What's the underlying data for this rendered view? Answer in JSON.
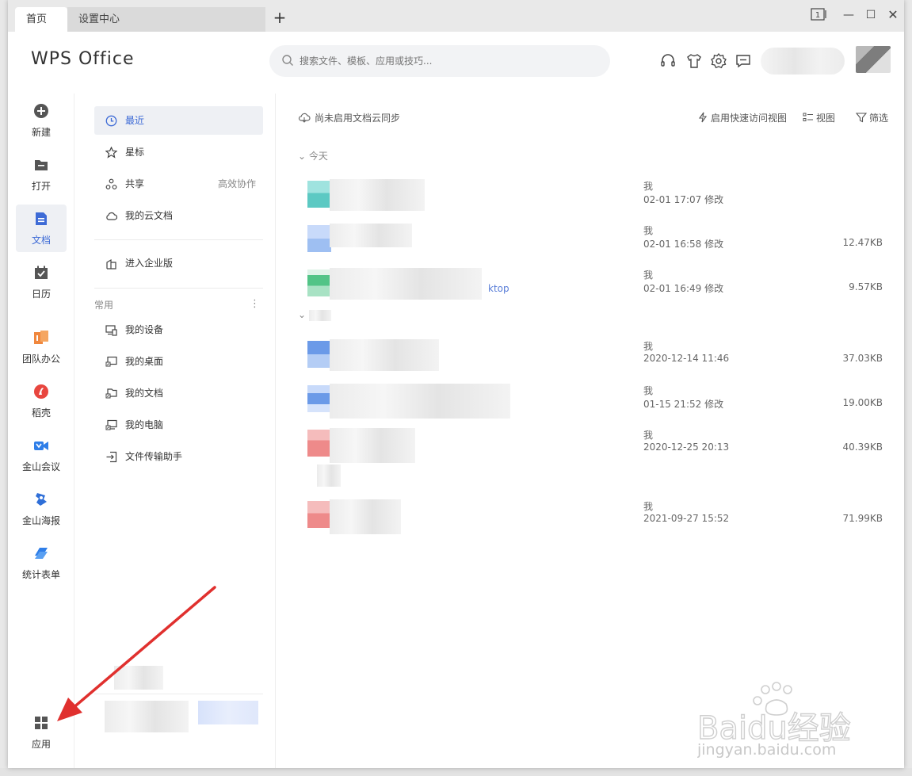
{
  "tabs": [
    {
      "label": "首页",
      "active": true
    },
    {
      "label": "设置中心",
      "active": false
    }
  ],
  "window_controls": {
    "pad": "1",
    "minimize": "—",
    "maximize": "☐",
    "close": "✕"
  },
  "header": {
    "logo": "WPS Office",
    "search_placeholder": "搜索文件、模板、应用或技巧..."
  },
  "left_bar": {
    "items": [
      {
        "label": "新建",
        "icon": "plus-circle-icon"
      },
      {
        "label": "打开",
        "icon": "folder-icon"
      },
      {
        "label": "文档",
        "icon": "document-icon",
        "active": true
      },
      {
        "label": "日历",
        "icon": "calendar-icon"
      },
      {
        "label": "团队办公",
        "icon": "team-icon"
      },
      {
        "label": "稻壳",
        "icon": "docer-icon"
      },
      {
        "label": "金山会议",
        "icon": "meeting-icon"
      },
      {
        "label": "金山海报",
        "icon": "poster-icon"
      },
      {
        "label": "统计表单",
        "icon": "form-icon"
      }
    ],
    "apps_label": "应用"
  },
  "nav": {
    "items": [
      {
        "label": "最近",
        "icon": "clock-icon",
        "active": true
      },
      {
        "label": "星标",
        "icon": "star-icon"
      },
      {
        "label": "共享",
        "icon": "share-icon",
        "extra": "高效协作"
      },
      {
        "label": "我的云文档",
        "icon": "cloud-icon"
      }
    ],
    "enterprise": "进入企业版",
    "section_label": "常用",
    "section_more": "⋮",
    "common": [
      {
        "label": "我的设备",
        "icon": "device-icon"
      },
      {
        "label": "我的桌面",
        "icon": "desktop-icon"
      },
      {
        "label": "我的文档",
        "icon": "folder-shortcut-icon"
      },
      {
        "label": "我的电脑",
        "icon": "computer-icon"
      },
      {
        "label": "文件传输助手",
        "icon": "transfer-icon"
      }
    ]
  },
  "main": {
    "cloud_note": "尚未启用文档云同步",
    "toolbar": {
      "quick_view": "启用快速访问视图",
      "view": "视图",
      "filter": "筛选"
    },
    "group_today": "今天",
    "files": [
      {
        "owner": "我",
        "time": "02-01 17:07 修改",
        "size": "",
        "color": "#5cc9c3"
      },
      {
        "owner": "我",
        "time": "02-01 16:58 修改",
        "size": "12.47KB",
        "color": "#9ebff2"
      },
      {
        "owner": "我",
        "time": "02-01 16:49 修改",
        "size": "9.57KB",
        "color": "#52c487",
        "tail": "ktop"
      },
      {
        "owner": "我",
        "time": "2020-12-14 11:46",
        "size": "37.03KB",
        "color": "#6b9ae8"
      },
      {
        "owner": "我",
        "time": "01-15 21:52 修改",
        "size": "19.00KB",
        "color": "#6b9ae8"
      },
      {
        "owner": "我",
        "time": "2020-12-25 20:13",
        "size": "40.39KB",
        "color": "#ee8a8a"
      },
      {
        "owner": "我",
        "time": "2021-09-27 15:52",
        "size": "71.99KB",
        "color": "#ee8a8a"
      }
    ]
  },
  "watermark": {
    "brand": "Baidu经验",
    "url": "jingyan.baidu.com"
  },
  "colors": {
    "accent": "#3e6bd6",
    "arrow": "#e0302e"
  }
}
